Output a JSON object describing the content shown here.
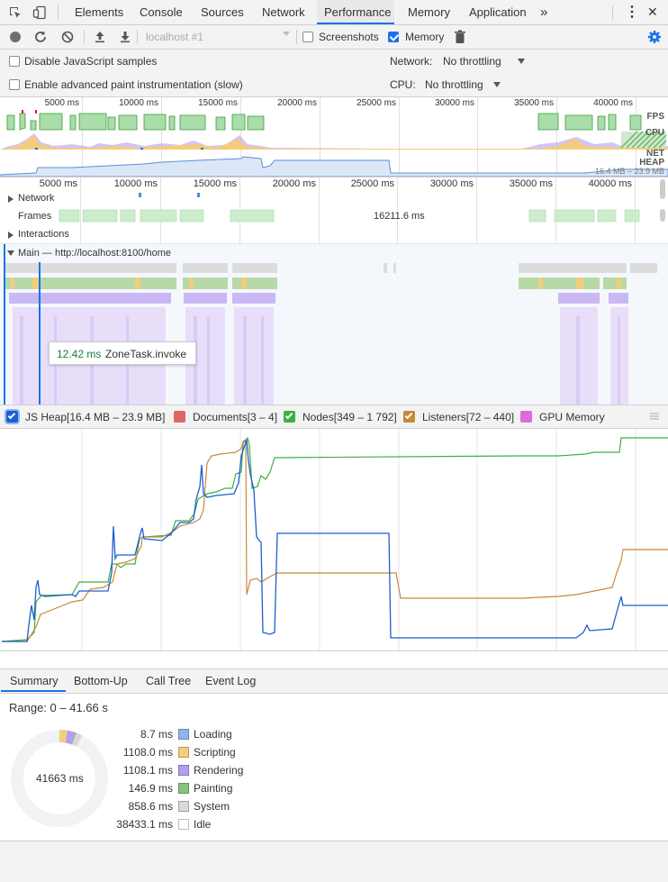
{
  "toolbar": {
    "tabs": [
      "Elements",
      "Console",
      "Sources",
      "Network",
      "Performance",
      "Memory",
      "Application"
    ],
    "active_tab": "Performance",
    "more_tabs_glyph": "»",
    "menu_glyph": "⋮",
    "close_glyph": "✕"
  },
  "controls": {
    "recording_select": "localhost #1",
    "screenshots_label": "Screenshots",
    "screenshots_checked": false,
    "memory_label": "Memory",
    "memory_checked": true
  },
  "settings": {
    "disable_js_samples": "Disable JavaScript samples",
    "advanced_paint": "Enable advanced paint instrumentation (slow)",
    "network_label": "Network:",
    "network_value": "No throttling",
    "cpu_label": "CPU:",
    "cpu_value": "No throttling"
  },
  "overview": {
    "ticks": [
      "5000 ms",
      "10000 ms",
      "15000 ms",
      "20000 ms",
      "25000 ms",
      "30000 ms",
      "35000 ms",
      "40000 ms"
    ],
    "fps_label": "FPS",
    "cpu_label": "CPU",
    "net_label": "NET",
    "heap_label": "HEAP",
    "heap_range": "16.4 MB – 23.9 MB"
  },
  "timeline": {
    "ticks": [
      "5000 ms",
      "10000 ms",
      "15000 ms",
      "20000 ms",
      "25000 ms",
      "30000 ms",
      "35000 ms",
      "40000 ms"
    ],
    "network_track": "Network",
    "frames_track": "Frames",
    "frames_value": "16211.6 ms",
    "interactions_track": "Interactions",
    "main_track": "Main — http://localhost:8100/home",
    "tooltip_time": "12.42 ms",
    "tooltip_name": "ZoneTask.invoke"
  },
  "counters": [
    {
      "label": "JS Heap[16.4 MB – 23.9 MB]",
      "color": "#1a5fd0",
      "checked": true
    },
    {
      "label": "Documents[3 – 4]",
      "color": "#e06666",
      "checked": false
    },
    {
      "label": "Nodes[349 – 1 792]",
      "color": "#3cb043",
      "checked": true
    },
    {
      "label": "Listeners[72 – 440]",
      "color": "#c8883a",
      "checked": true
    },
    {
      "label": "GPU Memory",
      "color": "#e06ad9",
      "checked": false
    }
  ],
  "bottom_tabs": [
    "Summary",
    "Bottom-Up",
    "Call Tree",
    "Event Log"
  ],
  "summary": {
    "range": "Range: 0 – 41.66 s",
    "total": "41663 ms",
    "rows": [
      {
        "value": "8.7 ms",
        "label": "Loading",
        "color": "#8fb3ea"
      },
      {
        "value": "1108.0 ms",
        "label": "Scripting",
        "color": "#f4cd7c"
      },
      {
        "value": "1108.1 ms",
        "label": "Rendering",
        "color": "#b49df0"
      },
      {
        "value": "146.9 ms",
        "label": "Painting",
        "color": "#86c47f"
      },
      {
        "value": "858.6 ms",
        "label": "System",
        "color": "#d9d9d9"
      },
      {
        "value": "38433.1 ms",
        "label": "Idle",
        "color": "#ffffff"
      }
    ]
  }
}
